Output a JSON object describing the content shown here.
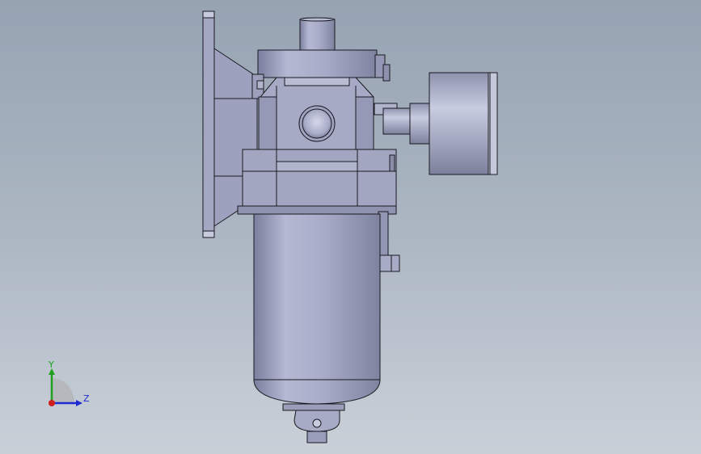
{
  "viewport": {
    "background_top": "#96a3b2",
    "background_bottom": "#c9d0d8"
  },
  "model": {
    "body_color": "#a0a4c0",
    "edge_color": "#1a1a22"
  },
  "triad": {
    "y_label": "Y",
    "z_label": "Z",
    "y_color": "#1ea01e",
    "z_color": "#1e2ad0",
    "x_color": "#d01e1e"
  }
}
